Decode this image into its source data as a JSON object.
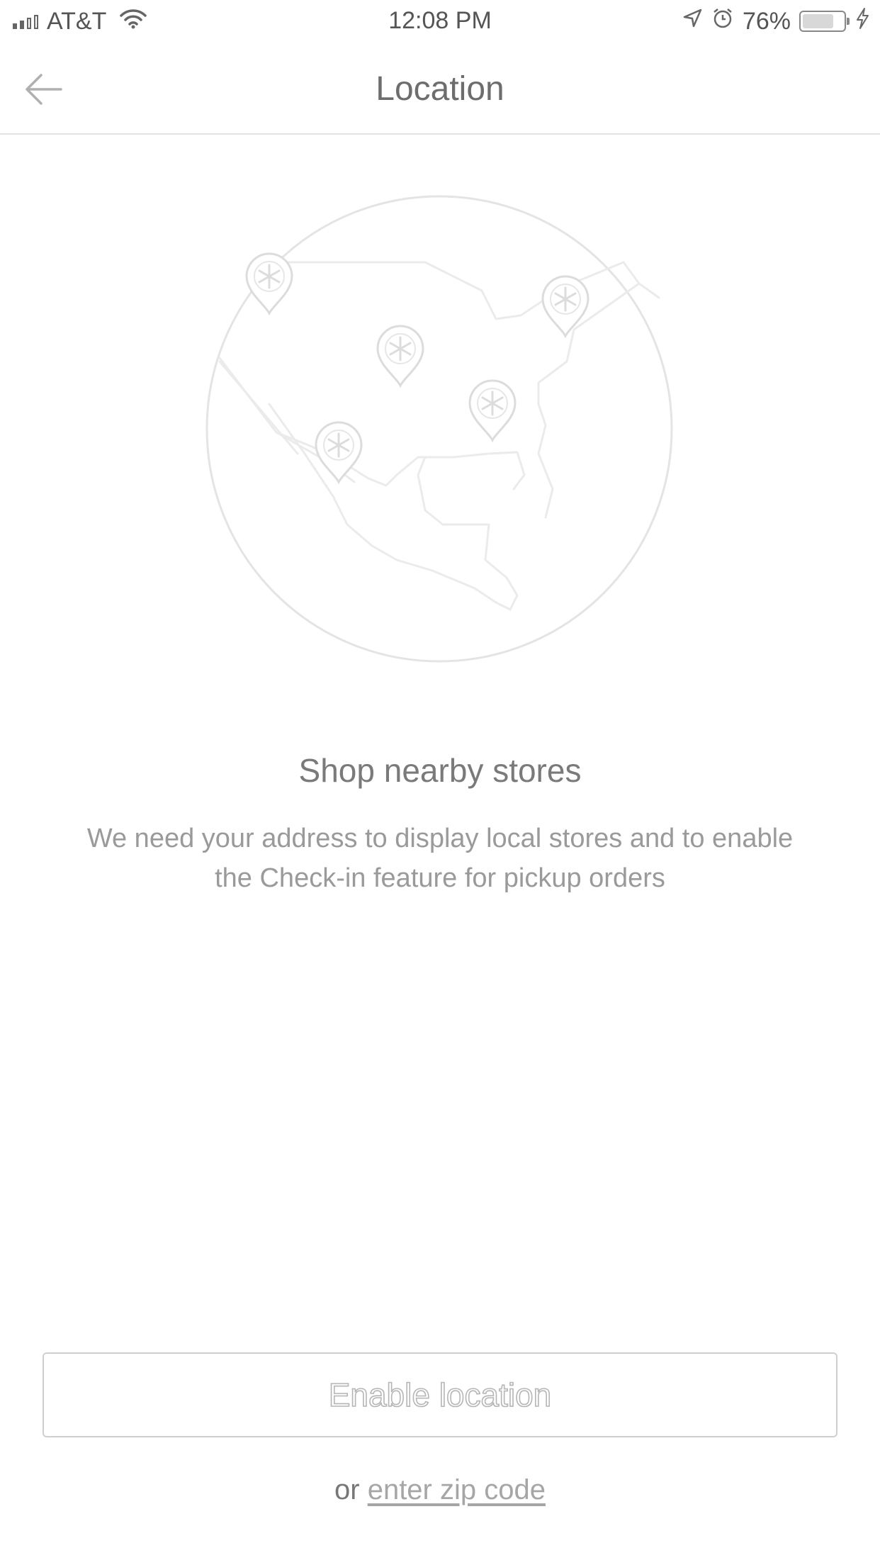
{
  "status_bar": {
    "carrier": "AT&T",
    "time": "12:08 PM",
    "battery_percent": "76%",
    "battery_level": 0.76,
    "icons": [
      "signal-icon",
      "wifi-icon",
      "location-arrow-icon",
      "alarm-icon",
      "battery-icon",
      "charging-bolt-icon"
    ]
  },
  "nav": {
    "title": "Location",
    "back_icon": "back-arrow-icon"
  },
  "illustration": {
    "icon": "globe-map-with-store-pins",
    "pin_count": 5
  },
  "content": {
    "headline": "Shop nearby stores",
    "description": "We need your address to display local stores and to enable the Check-in feature for pickup orders"
  },
  "actions": {
    "enable_label": "Enable location",
    "or_text": "or",
    "zip_link": "enter zip code"
  },
  "colors": {
    "text_primary": "#6d6d6d",
    "text_secondary": "#9a9a9a",
    "divider": "#e3e3e3",
    "illustration_stroke": "#e2e2e2"
  }
}
